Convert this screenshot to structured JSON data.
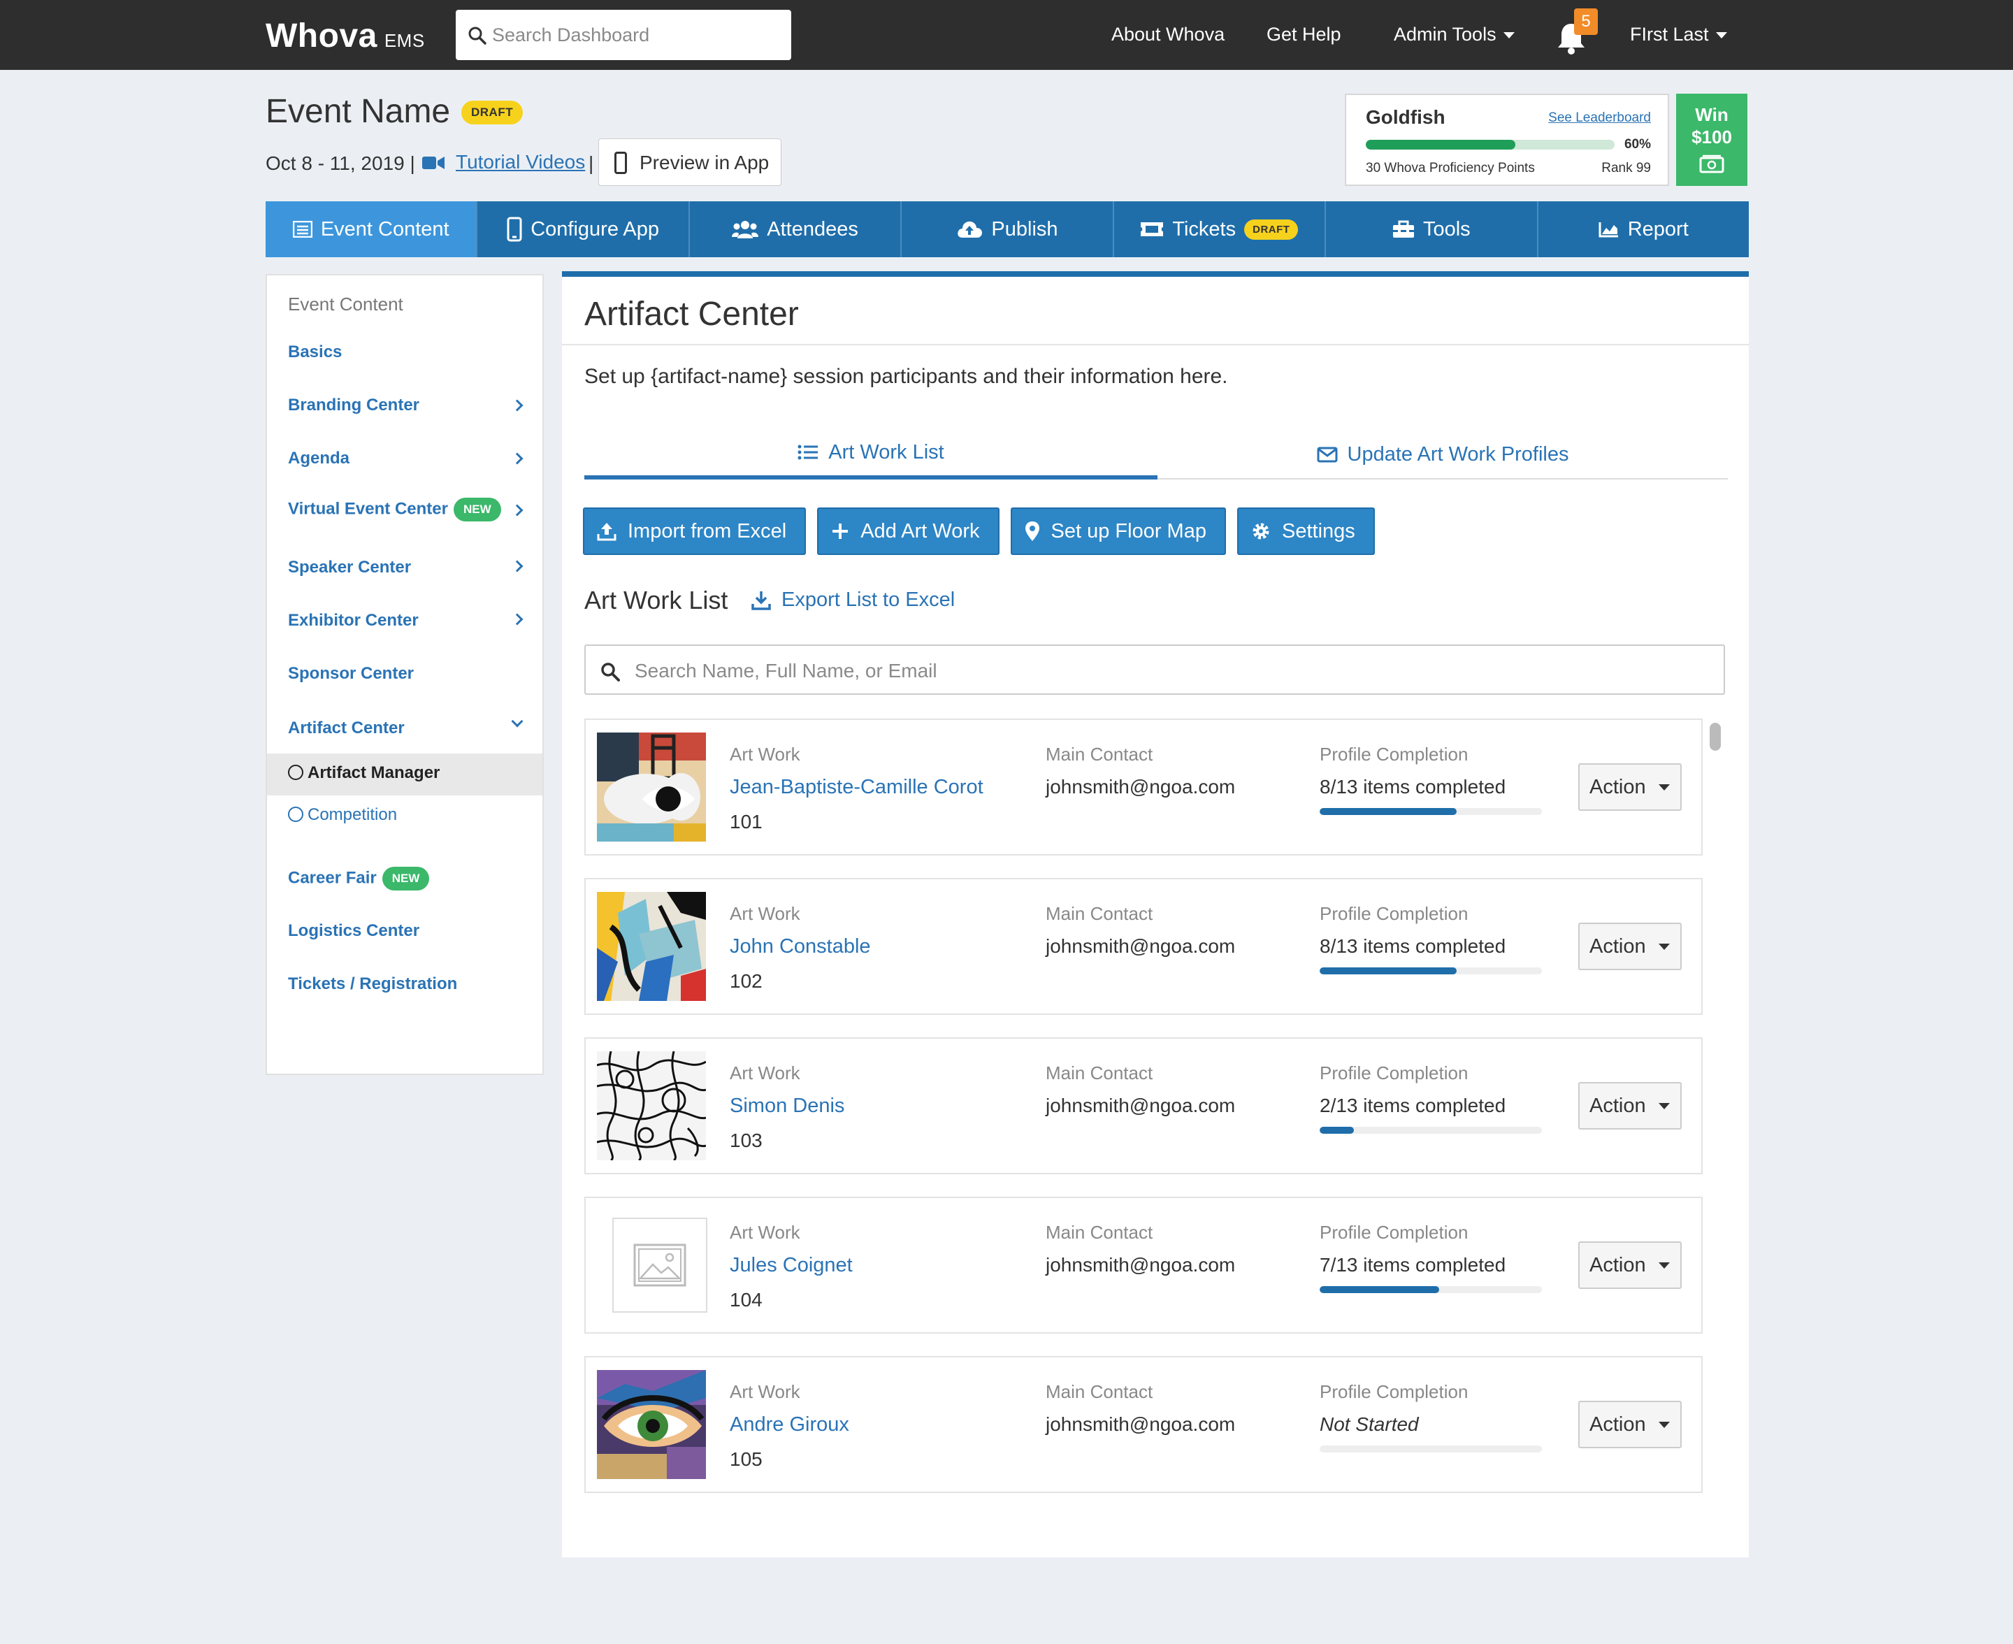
{
  "topbar": {
    "brand": "Whova",
    "brand_sub": "EMS",
    "search_placeholder": "Search Dashboard",
    "links": {
      "about": "About Whova",
      "help": "Get Help",
      "admin": "Admin Tools"
    },
    "notifications": "5",
    "user": "FIrst Last"
  },
  "event": {
    "title": "Event Name",
    "status": "DRAFT",
    "date": "Oct 8 - 11, 2019 |",
    "tutorial": "Tutorial Videos",
    "sep": "|",
    "preview": "Preview in App"
  },
  "gamification": {
    "level": "Goldfish",
    "leaderboard": "See Leaderboard",
    "progress_pct": "60%",
    "progress": 0.6,
    "points": "30 Whova Proficiency Points",
    "rank": "Rank 99",
    "win_line1": "Win",
    "win_line2": "$100"
  },
  "tabs": [
    {
      "label": "Event Content",
      "icon": "list-icon"
    },
    {
      "label": "Configure App",
      "icon": "phone-icon"
    },
    {
      "label": "Attendees",
      "icon": "users-icon"
    },
    {
      "label": "Publish",
      "icon": "cloud-upload-icon"
    },
    {
      "label": "Tickets",
      "icon": "ticket-icon",
      "badge": "DRAFT"
    },
    {
      "label": "Tools",
      "icon": "toolbox-icon"
    },
    {
      "label": "Report",
      "icon": "chart-icon"
    }
  ],
  "sidebar": {
    "header": "Event Content",
    "items": [
      {
        "label": "Basics"
      },
      {
        "label": "Branding Center"
      },
      {
        "label": "Agenda"
      },
      {
        "label": "Virtual Event Center",
        "badge": "NEW"
      },
      {
        "label": "Speaker Center"
      },
      {
        "label": "Exhibitor Center"
      },
      {
        "label": "Sponsor Center"
      },
      {
        "label": "Artifact Center"
      },
      {
        "label": "Career Fair",
        "badge": "NEW"
      },
      {
        "label": "Logistics Center"
      },
      {
        "label": "Tickets / Registration"
      }
    ],
    "sub_items": [
      {
        "label": "Artifact Manager"
      },
      {
        "label": "Competition"
      }
    ]
  },
  "main": {
    "title": "Artifact Center",
    "description": "Set up {artifact-name} session participants and their information here.",
    "subtabs": [
      "Art Work List",
      "Update Art Work Profiles"
    ],
    "buttons": {
      "import": "Import from Excel",
      "add": "Add Art Work",
      "floor": "Set up Floor Map",
      "settings": "Settings"
    },
    "list_title": "Art Work List",
    "export": "Export List to Excel",
    "search_placeholder": "Search Name, Full Name, or Email",
    "col_labels": {
      "artwork": "Art Work",
      "contact": "Main Contact",
      "completion": "Profile Completion",
      "action": "Action"
    },
    "rows": [
      {
        "name": "Jean-Baptiste-Camille Corot",
        "number": "101",
        "email": "johnsmith@ngoa.com",
        "completion": "8/13 items completed",
        "progress": 0.615
      },
      {
        "name": "John Constable",
        "number": "102",
        "email": "johnsmith@ngoa.com",
        "completion": "8/13 items completed",
        "progress": 0.615
      },
      {
        "name": "Simon Denis",
        "number": "103",
        "email": "johnsmith@ngoa.com",
        "completion": "2/13 items completed",
        "progress": 0.154
      },
      {
        "name": "Jules Coignet",
        "number": "104",
        "email": "johnsmith@ngoa.com",
        "completion": "7/13 items completed",
        "progress": 0.538
      },
      {
        "name": "Andre Giroux",
        "number": "105",
        "email": "johnsmith@ngoa.com",
        "completion": "Not Started",
        "progress": 0
      }
    ]
  },
  "colors": {
    "primary": "#1f6eaa",
    "tab_active": "#3d96dc",
    "button": "#2d86c6",
    "success": "#3bb86a",
    "draft": "#f7d21c",
    "notification": "#f28c28"
  }
}
